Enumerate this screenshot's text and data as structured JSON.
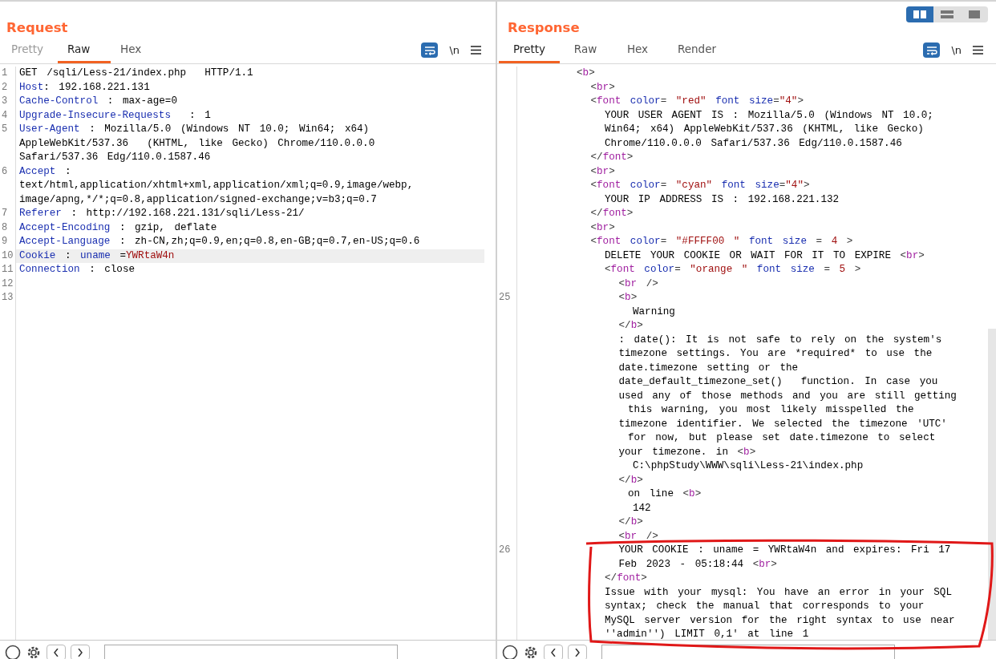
{
  "layout_toggle": [
    {
      "selected": true
    },
    {
      "selected": false
    },
    {
      "selected": false
    }
  ],
  "request": {
    "title": "Request",
    "tabs": [
      {
        "label": "Pretty",
        "selected": false,
        "disabled": true
      },
      {
        "label": "Raw",
        "selected": true,
        "disabled": false
      },
      {
        "label": "Hex",
        "selected": false,
        "disabled": false
      }
    ],
    "newline_toggle": "\\n",
    "lines": [
      {
        "number": "1",
        "selected": false,
        "lines": [
          [
            {
              "kind": "text",
              "text": "GET /sqli/Less-21/index.php  HTTP/1.1"
            }
          ]
        ]
      },
      {
        "number": "2",
        "selected": false,
        "lines": [
          [
            {
              "kind": "attr",
              "text": "Host"
            },
            {
              "kind": "text",
              "text": ": 192.168.221.131"
            }
          ]
        ]
      },
      {
        "number": "3",
        "selected": false,
        "lines": [
          [
            {
              "kind": "attr",
              "text": "Cache-Control"
            },
            {
              "kind": "text",
              "text": " : max-age=0"
            }
          ]
        ]
      },
      {
        "number": "4",
        "selected": false,
        "lines": [
          [
            {
              "kind": "attr",
              "text": "Upgrade-Insecure-Requests"
            },
            {
              "kind": "text",
              "text": "  : 1"
            }
          ]
        ]
      },
      {
        "number": "5",
        "selected": false,
        "lines": [
          [
            {
              "kind": "attr",
              "text": "User-Agent"
            },
            {
              "kind": "text",
              "text": " : Mozilla/5.0 (Windows NT 10.0; Win64; x64)"
            }
          ],
          [
            {
              "kind": "text",
              "text": "AppleWebKit/537.36  (KHTML, like Gecko) Chrome/110.0.0.0"
            }
          ],
          [
            {
              "kind": "text",
              "text": "Safari/537.36 Edg/110.0.1587.46"
            }
          ]
        ]
      },
      {
        "number": "6",
        "selected": false,
        "lines": [
          [
            {
              "kind": "attr",
              "text": "Accept"
            },
            {
              "kind": "text",
              "text": " :"
            }
          ],
          [
            {
              "kind": "text",
              "text": "text/html,application/xhtml+xml,application/xml;q=0.9,image/webp,"
            }
          ],
          [
            {
              "kind": "text",
              "text": "image/apng,*/*;q=0.8,application/signed-exchange;v=b3;q=0.7"
            }
          ]
        ]
      },
      {
        "number": "7",
        "selected": false,
        "lines": [
          [
            {
              "kind": "attr",
              "text": "Referer"
            },
            {
              "kind": "text",
              "text": " : http://192.168.221.131/sqli/Less-21/"
            }
          ]
        ]
      },
      {
        "number": "8",
        "selected": false,
        "lines": [
          [
            {
              "kind": "attr",
              "text": "Accept-Encoding"
            },
            {
              "kind": "text",
              "text": " : gzip, deflate"
            }
          ]
        ]
      },
      {
        "number": "9",
        "selected": false,
        "lines": [
          [
            {
              "kind": "attr",
              "text": "Accept-Language"
            },
            {
              "kind": "text",
              "text": " : zh-CN,zh;q=0.9,en;q=0.8,en-GB;q=0.7,en-US;q=0.6"
            }
          ]
        ]
      },
      {
        "number": "10",
        "selected": true,
        "lines": [
          [
            {
              "kind": "attr",
              "text": "Cookie"
            },
            {
              "kind": "text",
              "text": " : "
            },
            {
              "kind": "attr",
              "text": "uname"
            },
            {
              "kind": "text",
              "text": " ="
            },
            {
              "kind": "value",
              "text": "YWRtaW4n"
            }
          ]
        ]
      },
      {
        "number": "11",
        "selected": false,
        "lines": [
          [
            {
              "kind": "attr",
              "text": "Connection"
            },
            {
              "kind": "text",
              "text": " : close"
            }
          ]
        ]
      },
      {
        "number": "12",
        "selected": false
      },
      {
        "number": "13",
        "selected": false
      }
    ]
  },
  "response": {
    "title": "Response",
    "tabs": [
      {
        "label": "Pretty",
        "selected": true,
        "disabled": false
      },
      {
        "label": "Raw",
        "selected": false,
        "disabled": false
      },
      {
        "label": "Hex",
        "selected": false,
        "disabled": false
      },
      {
        "label": "Render",
        "selected": false,
        "disabled": false
      }
    ],
    "newline_toggle": "\\n",
    "nodes": [
      {
        "lines": [
          [
            {
              "kind": "punct",
              "text": "<"
            },
            {
              "kind": "tag",
              "text": "b"
            },
            {
              "kind": "punct",
              "text": ">"
            }
          ]
        ],
        "children": [
          {
            "lines": [
              [
                {
                  "kind": "punct",
                  "text": "<"
                },
                {
                  "kind": "tag",
                  "text": "br"
                },
                {
                  "kind": "punct",
                  "text": ">"
                }
              ]
            ]
          },
          {
            "lines": [
              [
                {
                  "kind": "punct",
                  "text": "<"
                },
                {
                  "kind": "tag",
                  "text": "font"
                },
                {
                  "kind": "attr",
                  "text": " color"
                },
                {
                  "kind": "punct",
                  "text": "= "
                },
                {
                  "kind": "value",
                  "text": "\"red\""
                },
                {
                  "kind": "attr",
                  "text": " font size"
                },
                {
                  "kind": "punct",
                  "text": "="
                },
                {
                  "kind": "value",
                  "text": "\"4\""
                },
                {
                  "kind": "punct",
                  "text": ">"
                }
              ]
            ],
            "children": [
              {
                "lines": [
                  [
                    {
                      "kind": "text",
                      "text": "YOUR USER AGENT IS : Mozilla/5.0 (Windows NT 10.0;"
                    }
                  ],
                  [
                    {
                      "kind": "text",
                      "text": "Win64; x64) AppleWebKit/537.36 (KHTML, like Gecko)"
                    }
                  ],
                  [
                    {
                      "kind": "text",
                      "text": "Chrome/110.0.0.0 Safari/537.36 Edg/110.0.1587.46"
                    }
                  ]
                ]
              }
            ]
          },
          {
            "lines": [
              [
                {
                  "kind": "punct",
                  "text": "</"
                },
                {
                  "kind": "tag",
                  "text": "font"
                },
                {
                  "kind": "punct",
                  "text": ">"
                }
              ]
            ]
          },
          {
            "lines": [
              [
                {
                  "kind": "punct",
                  "text": "<"
                },
                {
                  "kind": "tag",
                  "text": "br"
                },
                {
                  "kind": "punct",
                  "text": ">"
                }
              ]
            ]
          },
          {
            "lines": [
              [
                {
                  "kind": "punct",
                  "text": "<"
                },
                {
                  "kind": "tag",
                  "text": "font"
                },
                {
                  "kind": "attr",
                  "text": " color"
                },
                {
                  "kind": "punct",
                  "text": "= "
                },
                {
                  "kind": "value",
                  "text": "\"cyan\""
                },
                {
                  "kind": "attr",
                  "text": " font size"
                },
                {
                  "kind": "punct",
                  "text": "="
                },
                {
                  "kind": "value",
                  "text": "\"4\""
                },
                {
                  "kind": "punct",
                  "text": ">"
                }
              ]
            ],
            "children": [
              {
                "lines": [
                  [
                    {
                      "kind": "text",
                      "text": "YOUR IP ADDRESS IS : 192.168.221.132"
                    }
                  ]
                ]
              }
            ]
          },
          {
            "lines": [
              [
                {
                  "kind": "punct",
                  "text": "</"
                },
                {
                  "kind": "tag",
                  "text": "font"
                },
                {
                  "kind": "punct",
                  "text": ">"
                }
              ]
            ]
          },
          {
            "lines": [
              [
                {
                  "kind": "punct",
                  "text": "<"
                },
                {
                  "kind": "tag",
                  "text": "br"
                },
                {
                  "kind": "punct",
                  "text": ">"
                }
              ]
            ]
          },
          {
            "lines": [
              [
                {
                  "kind": "punct",
                  "text": "<"
                },
                {
                  "kind": "tag",
                  "text": "font"
                },
                {
                  "kind": "attr",
                  "text": " color"
                },
                {
                  "kind": "punct",
                  "text": "= "
                },
                {
                  "kind": "value",
                  "text": "\"#FFFF00 \""
                },
                {
                  "kind": "attr",
                  "text": " font size"
                },
                {
                  "kind": "punct",
                  "text": " = "
                },
                {
                  "kind": "value",
                  "text": "4"
                },
                {
                  "kind": "punct",
                  "text": " >"
                }
              ]
            ],
            "children": [
              {
                "lines": [
                  [
                    {
                      "kind": "text",
                      "text": "DELETE YOUR COOKIE OR WAIT FOR IT TO EXPIRE "
                    },
                    {
                      "kind": "punct",
                      "text": "<"
                    },
                    {
                      "kind": "tag",
                      "text": "br"
                    },
                    {
                      "kind": "punct",
                      "text": ">"
                    }
                  ]
                ]
              },
              {
                "lines": [
                  [
                    {
                      "kind": "punct",
                      "text": "<"
                    },
                    {
                      "kind": "tag",
                      "text": "font"
                    },
                    {
                      "kind": "attr",
                      "text": " color"
                    },
                    {
                      "kind": "punct",
                      "text": "= "
                    },
                    {
                      "kind": "value",
                      "text": "\"orange \""
                    },
                    {
                      "kind": "attr",
                      "text": " font size"
                    },
                    {
                      "kind": "punct",
                      "text": " = "
                    },
                    {
                      "kind": "value",
                      "text": "5"
                    },
                    {
                      "kind": "punct",
                      "text": " >"
                    }
                  ]
                ],
                "children": [
                  {
                    "lines": [
                      [
                        {
                          "kind": "punct",
                          "text": "<"
                        },
                        {
                          "kind": "tag",
                          "text": "br"
                        },
                        {
                          "kind": "punct",
                          "text": " />"
                        }
                      ]
                    ]
                  },
                  {
                    "number": "25",
                    "lines": [
                      [
                        {
                          "kind": "punct",
                          "text": "<"
                        },
                        {
                          "kind": "tag",
                          "text": "b"
                        },
                        {
                          "kind": "punct",
                          "text": ">"
                        }
                      ]
                    ],
                    "children": [
                      {
                        "lines": [
                          [
                            {
                              "kind": "text",
                              "text": "Warning"
                            }
                          ]
                        ]
                      }
                    ]
                  },
                  {
                    "lines": [
                      [
                        {
                          "kind": "punct",
                          "text": "</"
                        },
                        {
                          "kind": "tag",
                          "text": "b"
                        },
                        {
                          "kind": "punct",
                          "text": ">"
                        }
                      ]
                    ]
                  },
                  {
                    "lines": [
                      [
                        {
                          "kind": "text",
                          "text": ": date(): It is not safe to rely on the system's"
                        }
                      ],
                      [
                        {
                          "kind": "text",
                          "text": "timezone settings. You are *required* to use the"
                        }
                      ],
                      [
                        {
                          "kind": "text",
                          "text": "date.timezone setting or the"
                        }
                      ],
                      [
                        {
                          "kind": "text",
                          "text": "date_default_timezone_set()  function. In case you"
                        }
                      ],
                      [
                        {
                          "kind": "text",
                          "text": "used any of those methods and you are still getting"
                        }
                      ],
                      [
                        {
                          "kind": "text",
                          "text": " this warning, you most likely misspelled the"
                        }
                      ],
                      [
                        {
                          "kind": "text",
                          "text": "timezone identifier. We selected the timezone 'UTC'"
                        }
                      ],
                      [
                        {
                          "kind": "text",
                          "text": " for now, but please set date.timezone to select"
                        }
                      ],
                      [
                        {
                          "kind": "text",
                          "text": "your timezone. in "
                        },
                        {
                          "kind": "punct",
                          "text": "<"
                        },
                        {
                          "kind": "tag",
                          "text": "b"
                        },
                        {
                          "kind": "punct",
                          "text": ">"
                        }
                      ]
                    ],
                    "children": [
                      {
                        "lines": [
                          [
                            {
                              "kind": "text",
                              "text": "C:\\phpStudy\\WWW\\sqli\\Less-21\\index.php"
                            }
                          ]
                        ]
                      }
                    ]
                  },
                  {
                    "lines": [
                      [
                        {
                          "kind": "punct",
                          "text": "</"
                        },
                        {
                          "kind": "tag",
                          "text": "b"
                        },
                        {
                          "kind": "punct",
                          "text": ">"
                        }
                      ]
                    ]
                  },
                  {
                    "lines": [
                      [
                        {
                          "kind": "text",
                          "text": " on line "
                        },
                        {
                          "kind": "punct",
                          "text": "<"
                        },
                        {
                          "kind": "tag",
                          "text": "b"
                        },
                        {
                          "kind": "punct",
                          "text": ">"
                        }
                      ]
                    ],
                    "children": [
                      {
                        "lines": [
                          [
                            {
                              "kind": "text",
                              "text": "142"
                            }
                          ]
                        ]
                      }
                    ]
                  },
                  {
                    "lines": [
                      [
                        {
                          "kind": "punct",
                          "text": "</"
                        },
                        {
                          "kind": "tag",
                          "text": "b"
                        },
                        {
                          "kind": "punct",
                          "text": ">"
                        }
                      ]
                    ]
                  },
                  {
                    "lines": [
                      [
                        {
                          "kind": "punct",
                          "text": "<"
                        },
                        {
                          "kind": "tag",
                          "text": "br"
                        },
                        {
                          "kind": "punct",
                          "text": " />"
                        }
                      ]
                    ]
                  },
                  {
                    "number": "26",
                    "lines": [
                      [
                        {
                          "kind": "text",
                          "text": "YOUR COOKIE : uname = YWRtaW4n and expires: Fri 17"
                        }
                      ],
                      [
                        {
                          "kind": "text",
                          "text": "Feb 2023 - 05:18:44 "
                        },
                        {
                          "kind": "punct",
                          "text": "<"
                        },
                        {
                          "kind": "tag",
                          "text": "br"
                        },
                        {
                          "kind": "punct",
                          "text": ">"
                        }
                      ]
                    ]
                  }
                ]
              },
              {
                "lines": [
                  [
                    {
                      "kind": "punct",
                      "text": "</"
                    },
                    {
                      "kind": "tag",
                      "text": "font"
                    },
                    {
                      "kind": "punct",
                      "text": ">"
                    }
                  ]
                ]
              },
              {
                "lines": [
                  [
                    {
                      "kind": "text",
                      "text": "Issue with your mysql: You have an error in your SQL"
                    }
                  ],
                  [
                    {
                      "kind": "text",
                      "text": "syntax; check the manual that corresponds to your"
                    }
                  ],
                  [
                    {
                      "kind": "text",
                      "text": "MySQL server version for the right syntax to use near"
                    }
                  ],
                  [
                    {
                      "kind": "text",
                      "text": "''admin'') LIMIT 0,1' at line 1"
                    }
                  ]
                ]
              }
            ]
          }
        ]
      }
    ]
  }
}
